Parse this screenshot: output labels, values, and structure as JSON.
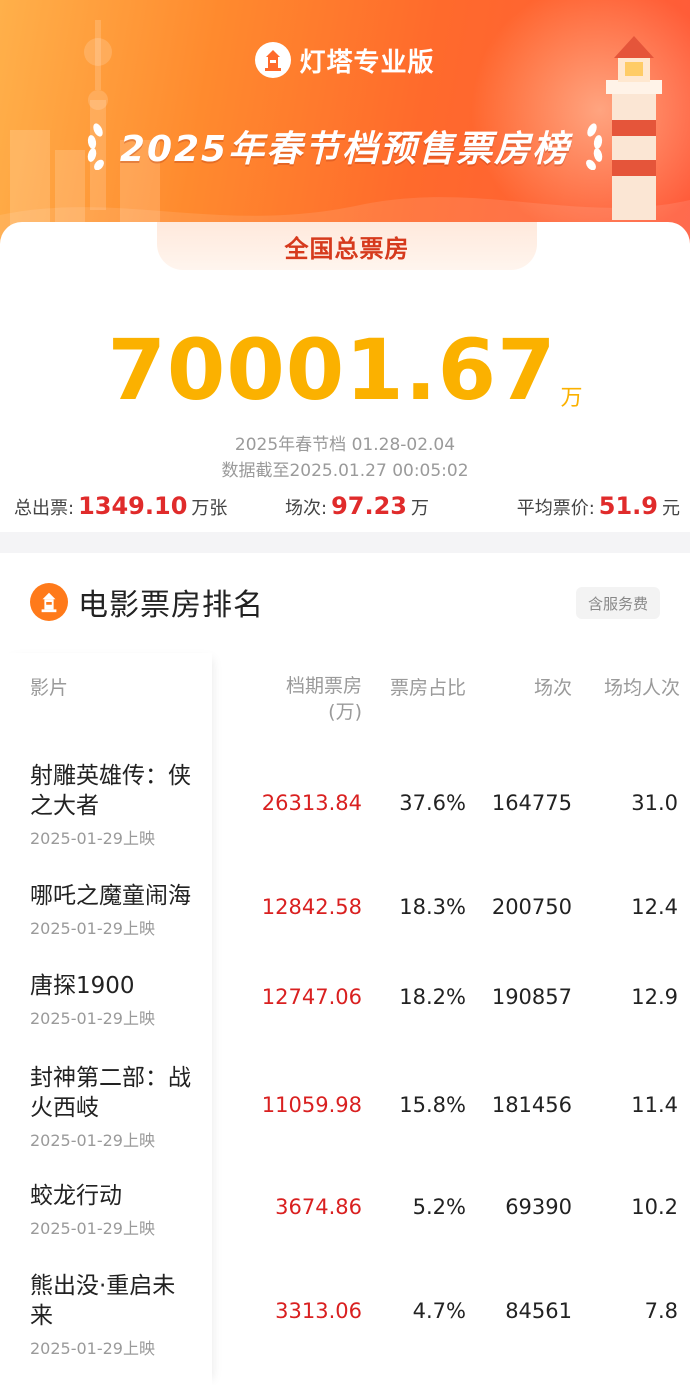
{
  "brand": {
    "name": "灯塔专业版"
  },
  "header": {
    "title": "2025年春节档预售票房榜"
  },
  "summary": {
    "label": "全国总票房",
    "total": "70001.67",
    "total_unit": "万",
    "period": "2025年春节档 01.28-02.04",
    "cutoff": "数据截至2025.01.27 00:05:02",
    "tickets_label": "总出票:",
    "tickets_value": "1349.10",
    "tickets_unit": "万张",
    "shows_label": "场次:",
    "shows_value": "97.23",
    "shows_unit": "万",
    "price_label": "平均票价:",
    "price_value": "51.9",
    "price_unit": "元"
  },
  "ranking": {
    "title": "电影票房排名",
    "fee_tag": "含服务费",
    "columns": {
      "movie": "影片",
      "box": "档期票房\n(万)",
      "share": "票房占比",
      "shows": "场次",
      "avg": "场均人次"
    },
    "rows": [
      {
        "name": "射雕英雄传：侠\n之大者",
        "date": "2025-01-29上映",
        "box": "26313.84",
        "share": "37.6%",
        "shows": "164775",
        "avg": "31.0"
      },
      {
        "name": "哪吒之魔童闹海",
        "date": "2025-01-29上映",
        "box": "12842.58",
        "share": "18.3%",
        "shows": "200750",
        "avg": "12.4"
      },
      {
        "name": "唐探1900",
        "date": "2025-01-29上映",
        "box": "12747.06",
        "share": "18.2%",
        "shows": "190857",
        "avg": "12.9"
      },
      {
        "name": "封神第二部：战\n火西岐",
        "date": "2025-01-29上映",
        "box": "11059.98",
        "share": "15.8%",
        "shows": "181456",
        "avg": "11.4"
      },
      {
        "name": "蛟龙行动",
        "date": "2025-01-29上映",
        "box": "3674.86",
        "share": "5.2%",
        "shows": "69390",
        "avg": "10.2"
      },
      {
        "name": "熊出没·重启未\n来",
        "date": "2025-01-29上映",
        "box": "3313.06",
        "share": "4.7%",
        "shows": "84561",
        "avg": "7.8"
      }
    ]
  },
  "colors": {
    "accent_orange": "#ff6a2c",
    "gold": "#fbb100",
    "red": "#d92020"
  },
  "icons": [
    "lighthouse-logo-icon",
    "laurel-left-icon",
    "laurel-right-icon"
  ]
}
